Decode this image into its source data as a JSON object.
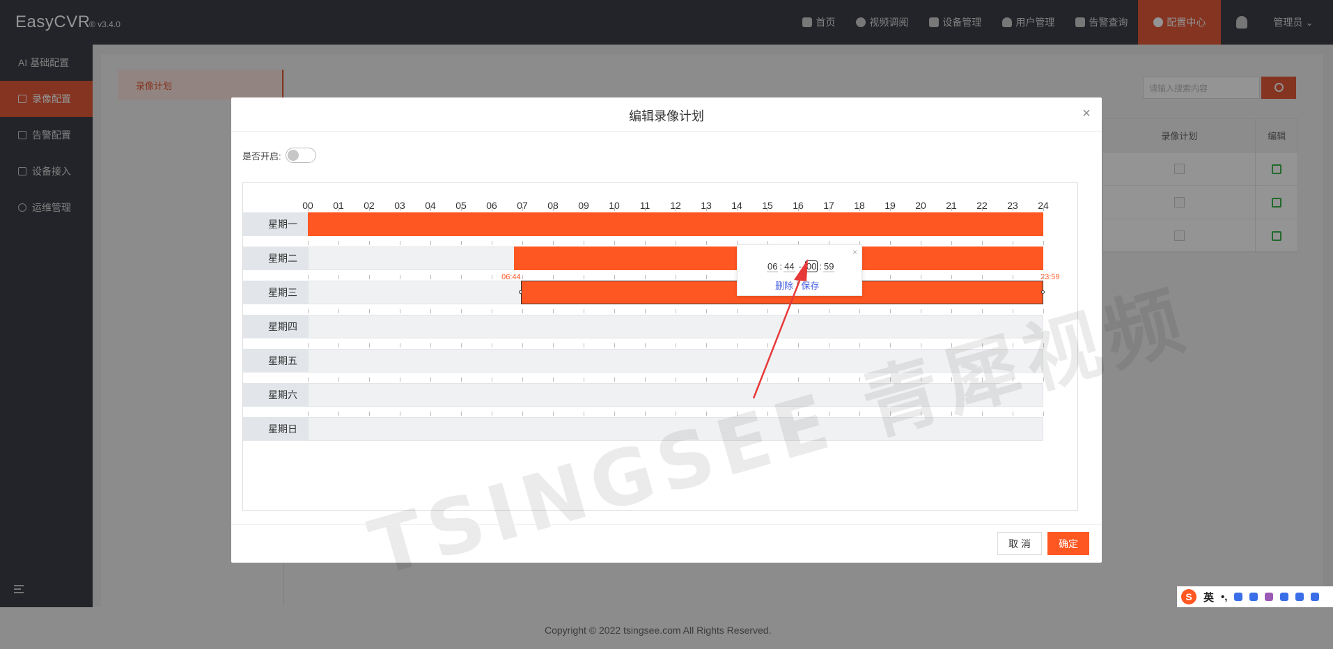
{
  "app": {
    "name": "EasyCVR",
    "version": "® v3.4.0"
  },
  "nav": [
    {
      "label": "首页",
      "icon": "dashboard-icon"
    },
    {
      "label": "视频调阅",
      "icon": "play-icon"
    },
    {
      "label": "设备管理",
      "icon": "device-icon"
    },
    {
      "label": "用户管理",
      "icon": "user-icon"
    },
    {
      "label": "告警查询",
      "icon": "alarm-icon"
    },
    {
      "label": "配置中心",
      "icon": "gear-icon",
      "active": true
    }
  ],
  "user_menu": "管理员 ⌄",
  "sidebar": [
    {
      "label": "AI 基础配置",
      "icon": "ai-icon"
    },
    {
      "label": "录像配置",
      "icon": "record-icon",
      "active": true
    },
    {
      "label": "告警配置",
      "icon": "alarm-icon"
    },
    {
      "label": "设备接入",
      "icon": "device-icon"
    },
    {
      "label": "运维管理",
      "icon": "tools-icon"
    }
  ],
  "subnav": {
    "item": "录像计划"
  },
  "background": {
    "search_placeholder": "请输入搜索内容",
    "table_headers": [
      "录像计划",
      "编辑"
    ],
    "rows": [
      {
        "checked": false
      },
      {
        "checked": false
      },
      {
        "checked": true
      }
    ]
  },
  "modal": {
    "title": "编辑录像计划",
    "close": "×",
    "enable_label": "是否开启:",
    "enabled": false,
    "hours": [
      "00",
      "01",
      "02",
      "03",
      "04",
      "05",
      "06",
      "07",
      "08",
      "09",
      "10",
      "11",
      "12",
      "13",
      "14",
      "15",
      "16",
      "17",
      "18",
      "19",
      "20",
      "21",
      "22",
      "23",
      "24"
    ],
    "days": [
      {
        "label": "星期一",
        "segments": [
          {
            "start": 0,
            "end": 24
          }
        ]
      },
      {
        "label": "星期二",
        "segments": [
          {
            "start": 6.73,
            "end": 24
          }
        ],
        "marks": [
          "06:44",
          "23:59"
        ]
      },
      {
        "label": "星期三",
        "segments": [
          {
            "start": 6.95,
            "end": 24,
            "selected": true
          }
        ]
      },
      {
        "label": "星期四",
        "segments": []
      },
      {
        "label": "星期五",
        "segments": []
      },
      {
        "label": "星期六",
        "segments": []
      },
      {
        "label": "星期日",
        "segments": []
      }
    ],
    "popup": {
      "start_h": "06",
      "start_m": "44",
      "sep": "-",
      "end_h": "00",
      "end_m": "59",
      "delete": "删除",
      "divider": "|",
      "save": "保存",
      "close": "×"
    },
    "cancel": "取 消",
    "ok": "确定"
  },
  "watermark": "TSINGSEE 青犀视频",
  "footer": "Copyright © 2022 tsingsee.com All Rights Reserved.",
  "ime": {
    "logo": "S",
    "lang": "英",
    "punct": "•,",
    "icons": [
      "mic-icon",
      "keyboard-icon",
      "skin-icon",
      "toolbox-icon",
      "grid-icon",
      "settings-icon"
    ]
  }
}
